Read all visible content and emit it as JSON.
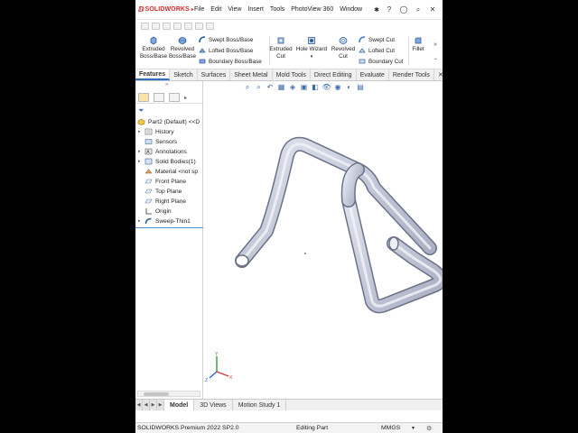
{
  "app": {
    "brand": "SOLIDWORKS"
  },
  "menu": [
    "File",
    "Edit",
    "View",
    "Insert",
    "Tools",
    "PhotoView 360",
    "Window"
  ],
  "ribbon": {
    "extruded_boss": [
      "Extruded",
      "Boss/Base"
    ],
    "revolved_boss": [
      "Revolved",
      "Boss/Base"
    ],
    "swept_boss": "Swept Boss/Base",
    "lofted_boss": "Lofted Boss/Base",
    "boundary_boss": "Boundary Boss/Base",
    "extruded_cut": [
      "Extruded",
      "Cut"
    ],
    "hole_wizard": "Hole Wizard",
    "revolved_cut": [
      "Revolved",
      "Cut"
    ],
    "swept_cut": "Swept Cut",
    "lofted_cut": "Lofted Cut",
    "boundary_cut": "Boundary Cut",
    "fillet": "Fillet"
  },
  "tabs": [
    "Features",
    "Sketch",
    "Surfaces",
    "Sheet Metal",
    "Mold Tools",
    "Direct Editing",
    "Evaluate",
    "Render Tools"
  ],
  "tree": {
    "root": "Part2 (Default) <<D",
    "items": [
      "History",
      "Sensors",
      "Annotations",
      "Solid Bodies(1)",
      "Material <not sp",
      "Front Plane",
      "Top Plane",
      "Right Plane",
      "Origin",
      "Sweep-Thin1"
    ]
  },
  "bottom_tabs": [
    "Model",
    "3D Views",
    "Motion Study 1"
  ],
  "status": {
    "version": "SOLIDWORKS Premium 2022 SP2.0",
    "mode": "Editing Part",
    "units": "MMGS"
  },
  "colors": {
    "accent": "#2f6fbf",
    "brand": "#d42a2a",
    "part": "#b9bfd2"
  }
}
